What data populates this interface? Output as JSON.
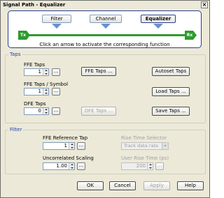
{
  "window": {
    "title": "Signal Path - Equalizer",
    "close_glyph": "×"
  },
  "signal_path": {
    "buttons": [
      "Filter",
      "Channel",
      "Equalizer"
    ],
    "active": "Equalizer",
    "tx_label": "Tx",
    "rx_label": "Rx",
    "hint": "Click an arrow to activate the corresponding function"
  },
  "taps": {
    "group_title": "Taps",
    "ffe_taps_label": "FFE Taps",
    "ffe_taps_value": "1",
    "ffe_taps_per_symbol_label": "FFE Taps / Symbol",
    "ffe_taps_per_symbol_value": "1",
    "dfe_taps_label": "DFE Taps",
    "dfe_taps_value": "0",
    "ffe_taps_button": "FFE Taps ...",
    "dfe_taps_button": "DFE Taps ...",
    "autoset_button": "Autoset Taps",
    "load_button": "Load Taps ...",
    "save_button": "Save Taps ...",
    "dots": "..."
  },
  "filter": {
    "group_title": "Filter",
    "ffe_ref_tap_label": "FFE Reference Tap",
    "ffe_ref_tap_value": "1",
    "uncorrelated_label": "Uncorrelated Scaling",
    "uncorrelated_value": "1.00",
    "rise_time_selector_label": "Rise Time Selector",
    "rise_time_selector_value": "Track data rate",
    "user_rise_time_label": "User Rise Time (ps)",
    "user_rise_time_value": "200",
    "dots": "..."
  },
  "footer": {
    "ok": "OK",
    "cancel": "Cancel",
    "apply": "Apply",
    "help": "Help"
  },
  "colors": {
    "accent": "#2a3f8a",
    "flow": "#2d9b2d",
    "group_title": "#1c3da3"
  }
}
